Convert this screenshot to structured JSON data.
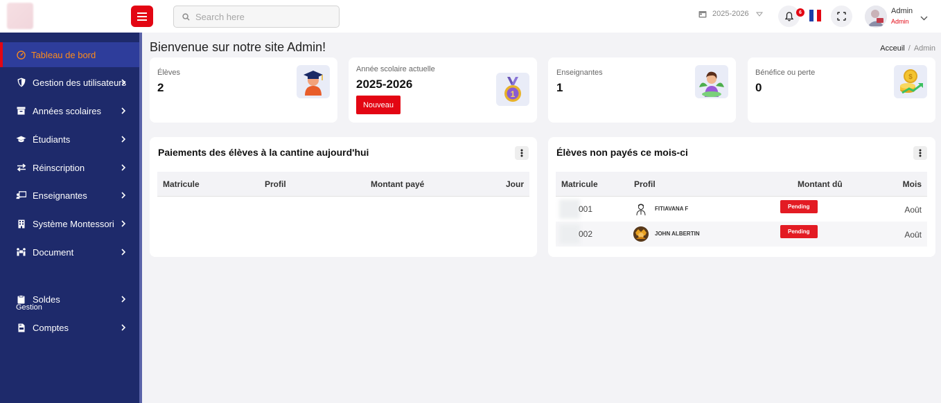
{
  "header": {
    "search_placeholder": "Search here",
    "school_year": "2025-2026",
    "notification_count": "6",
    "user_name": "Admin",
    "user_role": "Admin"
  },
  "sidebar": {
    "items": [
      {
        "label": "Tableau de bord",
        "icon": "dashboard-icon",
        "active": true
      },
      {
        "label": "Gestion des utilisateurs",
        "icon": "shield-icon"
      },
      {
        "label": "Années scolaires",
        "icon": "archive-icon"
      },
      {
        "label": "Étudiants",
        "icon": "graduation-cap-icon"
      },
      {
        "label": "Réinscription",
        "icon": "exchange-icon"
      },
      {
        "label": "Enseignantes",
        "icon": "chalkboard-teacher-icon"
      },
      {
        "label": "Système Montessori",
        "icon": "building-icon"
      },
      {
        "label": "Document",
        "icon": "people-carry-icon"
      },
      {
        "label": "Soldes",
        "icon": "clipboard-icon"
      },
      {
        "label": "Comptes",
        "icon": "file-invoice-icon"
      }
    ],
    "section_label": "Gestion"
  },
  "page": {
    "title": "Bienvenue sur notre site Admin!",
    "breadcrumb": [
      "Acceuil",
      "Admin"
    ]
  },
  "stats": [
    {
      "label": "Élèves",
      "value": "2",
      "icon": "graduate-icon"
    },
    {
      "label": "Année scolaire actuelle",
      "value": "2025-2026",
      "button": "Nouveau",
      "icon": "medal-icon"
    },
    {
      "label": "Enseignantes",
      "value": "1",
      "icon": "teacher-icon"
    },
    {
      "label": "Bénéfice ou perte",
      "value": "0",
      "icon": "coins-icon"
    }
  ],
  "payments_panel": {
    "title": "Paiements des élèves à la cantine aujourd'hui",
    "columns": [
      "Matricule",
      "Profil",
      "Montant payé",
      "Jour"
    ],
    "rows": []
  },
  "unpaid_panel": {
    "title": "Élèves non payés ce mois-ci",
    "columns": [
      "Matricule",
      "Profil",
      "Montant dû",
      "Mois"
    ],
    "rows": [
      {
        "matricule": "001",
        "name": "FITIAVANA F",
        "status": "Pending",
        "month": "Août"
      },
      {
        "matricule": "002",
        "name": "JOHN ALBERTIN",
        "status": "Pending",
        "month": "Août"
      }
    ]
  },
  "colors": {
    "primary": "#e30613",
    "sidebar": "#1e2a6b",
    "active_text": "#ff8c1a"
  }
}
